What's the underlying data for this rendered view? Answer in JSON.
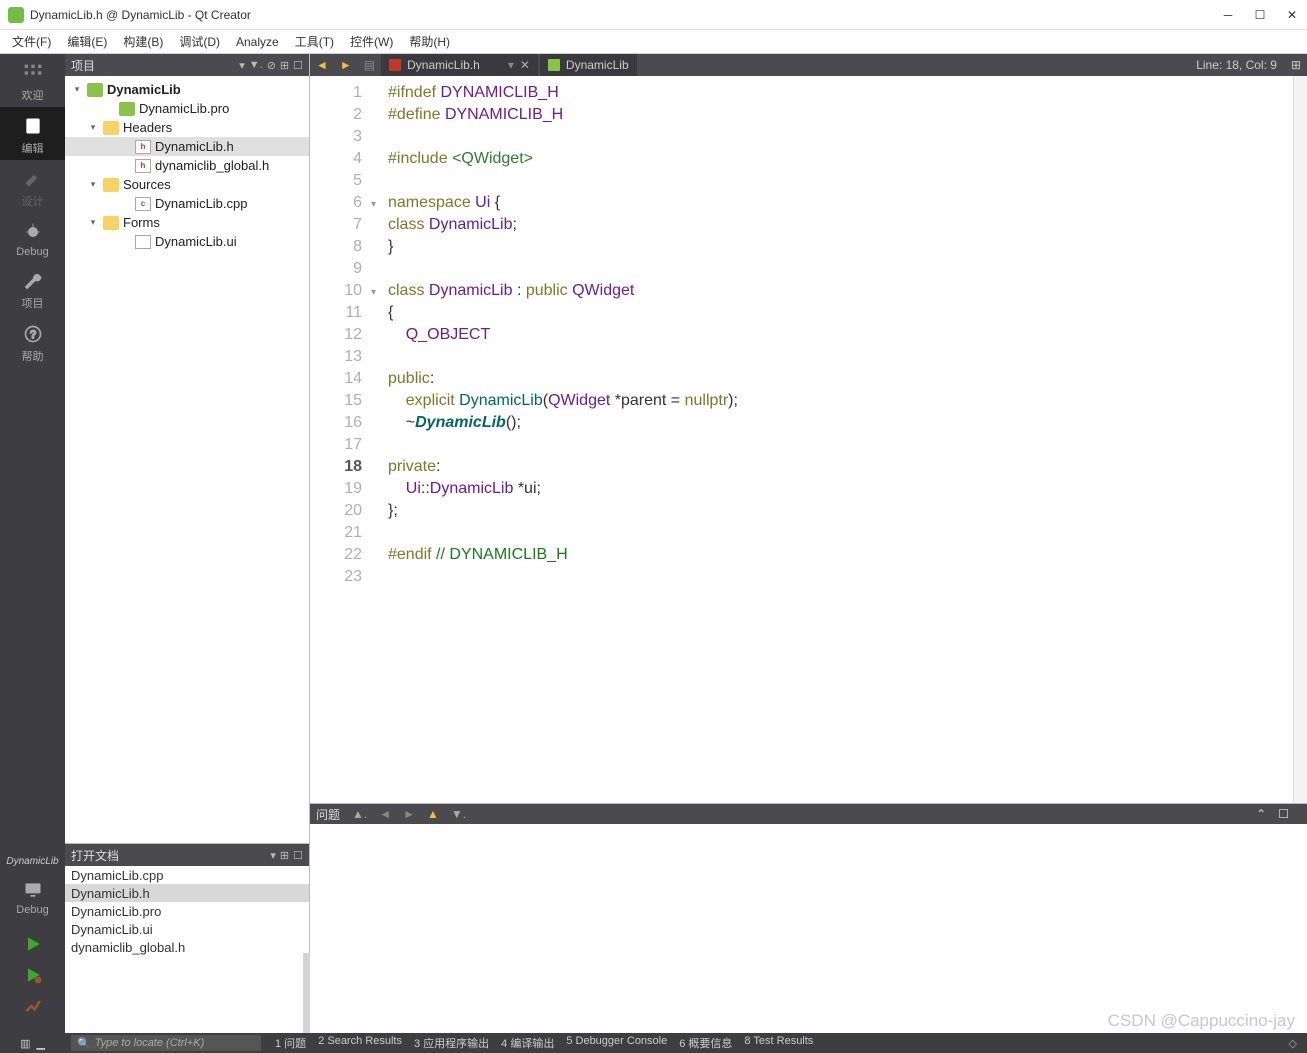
{
  "window": {
    "title": "DynamicLib.h @ DynamicLib - Qt Creator"
  },
  "menu": [
    "文件(F)",
    "编辑(E)",
    "构建(B)",
    "调试(D)",
    "Analyze",
    "工具(T)",
    "控件(W)",
    "帮助(H)"
  ],
  "modes": {
    "welcome": "欢迎",
    "edit": "编辑",
    "design": "设计",
    "debug": "Debug",
    "projects": "项目",
    "help": "帮助"
  },
  "kit": {
    "project": "DynamicLib",
    "config": "Debug"
  },
  "projectPanel": {
    "title": "项目"
  },
  "tree": {
    "project": "DynamicLib",
    "pro": "DynamicLib.pro",
    "headers": {
      "label": "Headers",
      "files": [
        "DynamicLib.h",
        "dynamiclib_global.h"
      ]
    },
    "sources": {
      "label": "Sources",
      "files": [
        "DynamicLib.cpp"
      ]
    },
    "forms": {
      "label": "Forms",
      "files": [
        "DynamicLib.ui"
      ]
    }
  },
  "openDocs": {
    "title": "打开文档",
    "items": [
      "DynamicLib.cpp",
      "DynamicLib.h",
      "DynamicLib.pro",
      "DynamicLib.ui",
      "dynamiclib_global.h"
    ],
    "selected": 1
  },
  "tabs": {
    "file": "DynamicLib.h",
    "project": "DynamicLib",
    "cursor": "Line: 18, Col: 9"
  },
  "issues": {
    "title": "问题"
  },
  "locator": {
    "placeholder": "Type to locate (Ctrl+K)"
  },
  "outputs": [
    "1 问题",
    "2 Search Results",
    "3 应用程序输出",
    "4 编译输出",
    "5 Debugger Console",
    "6 概要信息",
    "8 Test Results"
  ],
  "watermark": "CSDN @Cappuccino-jay",
  "code": {
    "lines": [
      {
        "n": 1,
        "html": "<span class='pp'>#ifndef</span> <span class='cls'>DYNAMICLIB_H</span>"
      },
      {
        "n": 2,
        "html": "<span class='pp'>#define</span> <span class='cls'>DYNAMICLIB_H</span>"
      },
      {
        "n": 3,
        "html": ""
      },
      {
        "n": 4,
        "html": "<span class='pp'>#include</span> <span class='pps'>&lt;QWidget&gt;</span>"
      },
      {
        "n": 5,
        "html": ""
      },
      {
        "n": 6,
        "html": "<span class='kw'>namespace</span> <span class='cls'>Ui</span> {",
        "fold": true
      },
      {
        "n": 7,
        "html": "<span class='kw'>class</span> <span class='cls'>DynamicLib</span>;"
      },
      {
        "n": 8,
        "html": "}"
      },
      {
        "n": 9,
        "html": ""
      },
      {
        "n": 10,
        "html": "<span class='kw'>class</span> <span class='cls'>DynamicLib</span> : <span class='kw'>public</span> <span class='cls'>QWidget</span>",
        "fold": true
      },
      {
        "n": 11,
        "html": "{"
      },
      {
        "n": 12,
        "html": "    <span class='cls'>Q_OBJECT</span>"
      },
      {
        "n": 13,
        "html": ""
      },
      {
        "n": 14,
        "html": "<span class='kw'>public</span>:"
      },
      {
        "n": 15,
        "html": "    <span class='kw'>explicit</span> <span class='func'>DynamicLib</span>(<span class='cls'>QWidget</span> *parent = <span class='kw'>nullptr</span>);"
      },
      {
        "n": 16,
        "html": "    ~<span class='ital'>DynamicLib</span>();"
      },
      {
        "n": 17,
        "html": ""
      },
      {
        "n": 18,
        "html": "<span class='kw'>private</span>:",
        "cur": true
      },
      {
        "n": 19,
        "html": "    <span class='cls'>Ui</span>::<span class='cls'>DynamicLib</span> *ui;"
      },
      {
        "n": 20,
        "html": "};"
      },
      {
        "n": 21,
        "html": ""
      },
      {
        "n": 22,
        "html": "<span class='pp'>#endif</span> <span class='comment'>// DYNAMICLIB_H</span>"
      },
      {
        "n": 23,
        "html": ""
      }
    ]
  }
}
